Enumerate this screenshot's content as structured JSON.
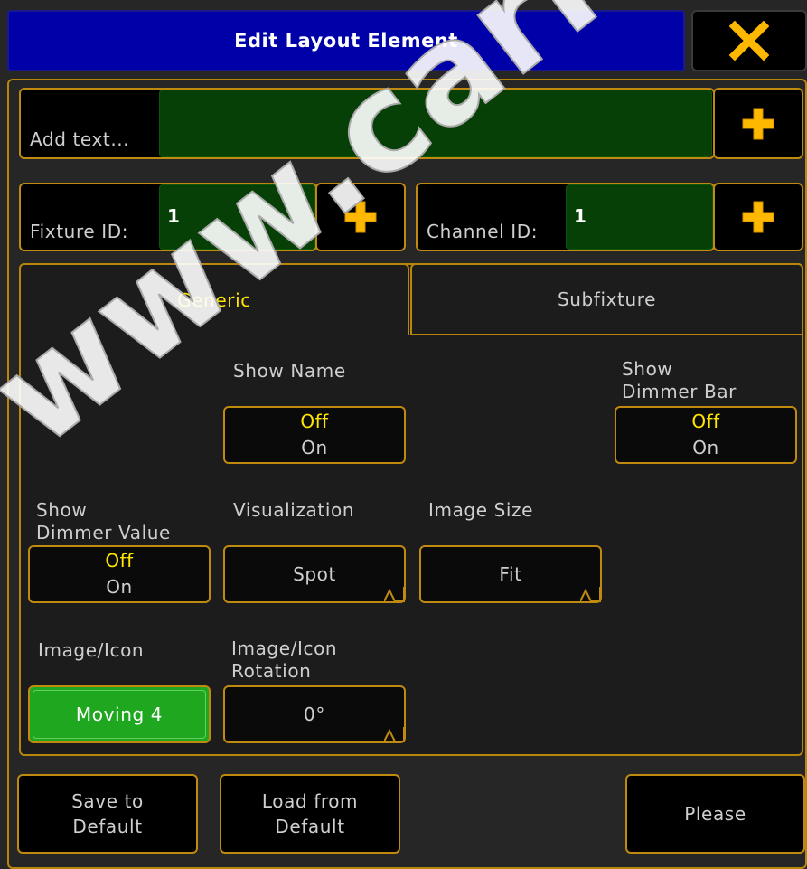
{
  "window": {
    "title": "Edit Layout Element",
    "close_icon": "close-x-icon"
  },
  "text_field": {
    "label": "Add text...",
    "value": ""
  },
  "fixture_id": {
    "label": "Fixture ID:",
    "value": "1"
  },
  "channel_id": {
    "label": "Channel ID:",
    "value": "1"
  },
  "tabs": [
    {
      "label": "Generic",
      "selected": true
    },
    {
      "label": "Subfixture",
      "selected": false
    }
  ],
  "generic": {
    "show_name": {
      "label": "Show Name",
      "off": "Off",
      "on": "On",
      "active": "Off"
    },
    "show_dimmer_bar": {
      "label_1": "Show",
      "label_2": "Dimmer Bar",
      "off": "Off",
      "on": "On",
      "active": "Off"
    },
    "show_dimmer_value": {
      "label_1": "Show",
      "label_2": "Dimmer Value",
      "off": "Off",
      "on": "On",
      "active": "Off"
    },
    "visualization": {
      "label": "Visualization",
      "value": "Spot"
    },
    "image_size": {
      "label": "Image Size",
      "value": "Fit"
    },
    "image_icon": {
      "label": "Image/Icon",
      "value": "Moving 4"
    },
    "image_icon_rotation": {
      "label_1": "Image/Icon",
      "label_2": "Rotation",
      "value": "0°"
    }
  },
  "footer": {
    "save_default_1": "Save to",
    "save_default_2": "Default",
    "load_default_1": "Load from",
    "load_default_2": "Default",
    "please": "Please"
  },
  "watermark": "www.carlosmene",
  "colors": {
    "title_bg": "#0000a8",
    "accent_border": "#c08a10",
    "input_green": "#064006",
    "active_green": "#1fa81f",
    "selected_text": "#ffe600",
    "plus_icon": "#ffb800"
  }
}
